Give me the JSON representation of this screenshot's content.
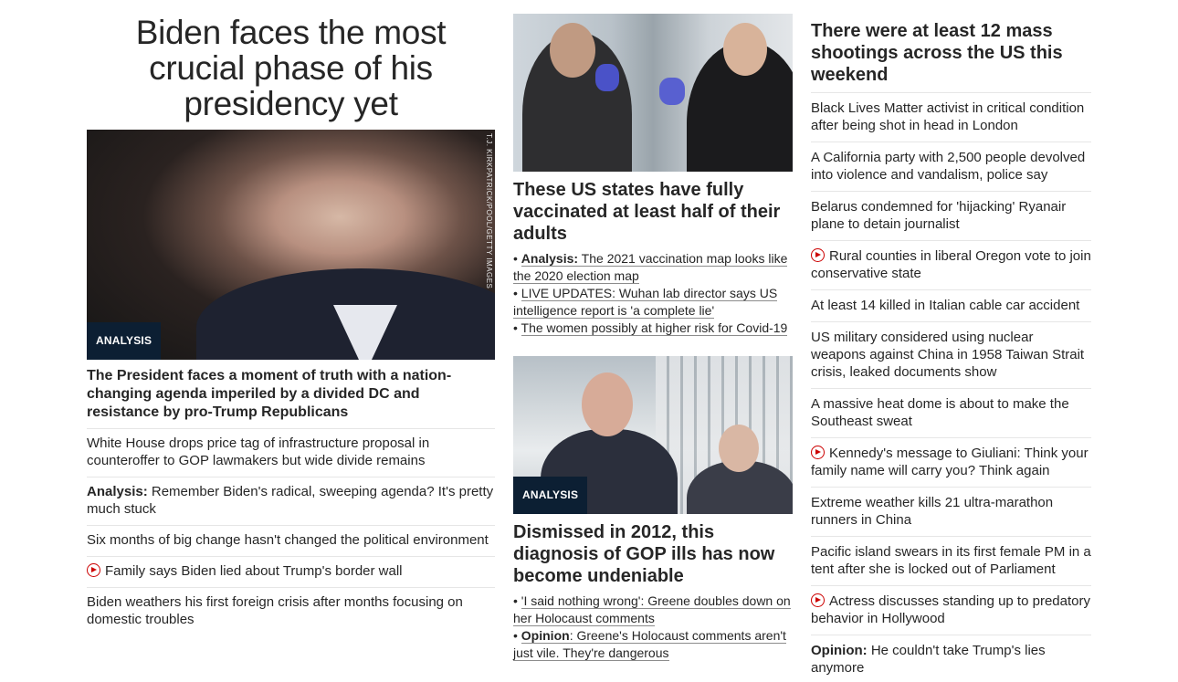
{
  "left": {
    "headline": "Biden faces the most crucial phase of his presidency yet",
    "image_credit": "T.J. KIRKPATRICK/POOL/GETTY IMAGES",
    "badge": "ANALYSIS",
    "subheadline": "The President faces a moment of truth with a nation-changing agenda imperiled by a divided DC and resistance by pro-Trump Republicans",
    "stories": [
      {
        "prefix": "",
        "text": "White House drops price tag of infrastructure proposal in counteroffer to GOP lawmakers but wide divide remains",
        "video": false
      },
      {
        "prefix": "Analysis:",
        "text": " Remember Biden's radical, sweeping agenda? It's pretty much stuck",
        "video": false
      },
      {
        "prefix": "",
        "text": "Six months of big change hasn't changed the political environment",
        "video": false
      },
      {
        "prefix": "",
        "text": "Family says Biden lied about Trump's border wall",
        "video": true
      },
      {
        "prefix": "",
        "text": "Biden weathers his first foreign crisis after months focusing on domestic troubles",
        "video": false
      }
    ]
  },
  "middle": {
    "story1": {
      "headline": "These US states have fully vaccinated at least half of their adults",
      "links": [
        {
          "prefix": "Analysis:",
          "text": " The 2021 vaccination map looks like the 2020 election map"
        },
        {
          "prefix": "",
          "text": "LIVE UPDATES: Wuhan lab director says US intelligence report is 'a complete lie'"
        },
        {
          "prefix": "",
          "text": "The women possibly at higher risk for Covid-19"
        }
      ]
    },
    "story2": {
      "badge": "ANALYSIS",
      "headline": "Dismissed in 2012, this diagnosis of GOP ills has now become undeniable",
      "links": [
        {
          "prefix": "",
          "text": "'I said nothing wrong': Greene doubles down on her Holocaust comments"
        },
        {
          "prefix": "Opinion",
          "text": ": Greene's Holocaust comments aren't just vile. They're dangerous"
        }
      ]
    }
  },
  "right": {
    "headline": "There were at least 12 mass shootings across the US this weekend",
    "stories": [
      {
        "prefix": "",
        "text": "Black Lives Matter activist in critical condition after being shot in head in London",
        "video": false
      },
      {
        "prefix": "",
        "text": "A California party with 2,500 people devolved into violence and vandalism, police say",
        "video": false
      },
      {
        "prefix": "",
        "text": "Belarus condemned for 'hijacking' Ryanair plane to detain journalist",
        "video": false
      },
      {
        "prefix": "",
        "text": "Rural counties in liberal Oregon vote to join conservative state",
        "video": true
      },
      {
        "prefix": "",
        "text": "At least 14 killed in Italian cable car accident",
        "video": false
      },
      {
        "prefix": "",
        "text": "US military considered using nuclear weapons against China in 1958 Taiwan Strait crisis, leaked documents show",
        "video": false
      },
      {
        "prefix": "",
        "text": "A massive heat dome is about to make the Southeast sweat",
        "video": false
      },
      {
        "prefix": "",
        "text": "Kennedy's message to Giuliani: Think your family name will carry you? Think again",
        "video": true
      },
      {
        "prefix": "",
        "text": "Extreme weather kills 21 ultra-marathon runners in China",
        "video": false
      },
      {
        "prefix": "",
        "text": "Pacific island swears in its first female PM in a tent after she is locked out of Parliament",
        "video": false
      },
      {
        "prefix": "",
        "text": "Actress discusses standing up to predatory behavior in Hollywood",
        "video": true
      },
      {
        "prefix": "Opinion:",
        "text": " He couldn't take Trump's lies anymore",
        "video": false
      }
    ]
  },
  "colors": {
    "text": "#262626",
    "badge_bg": "#0c1f33",
    "video_icon": "#cc0000",
    "divider": "#e6e6e6"
  }
}
